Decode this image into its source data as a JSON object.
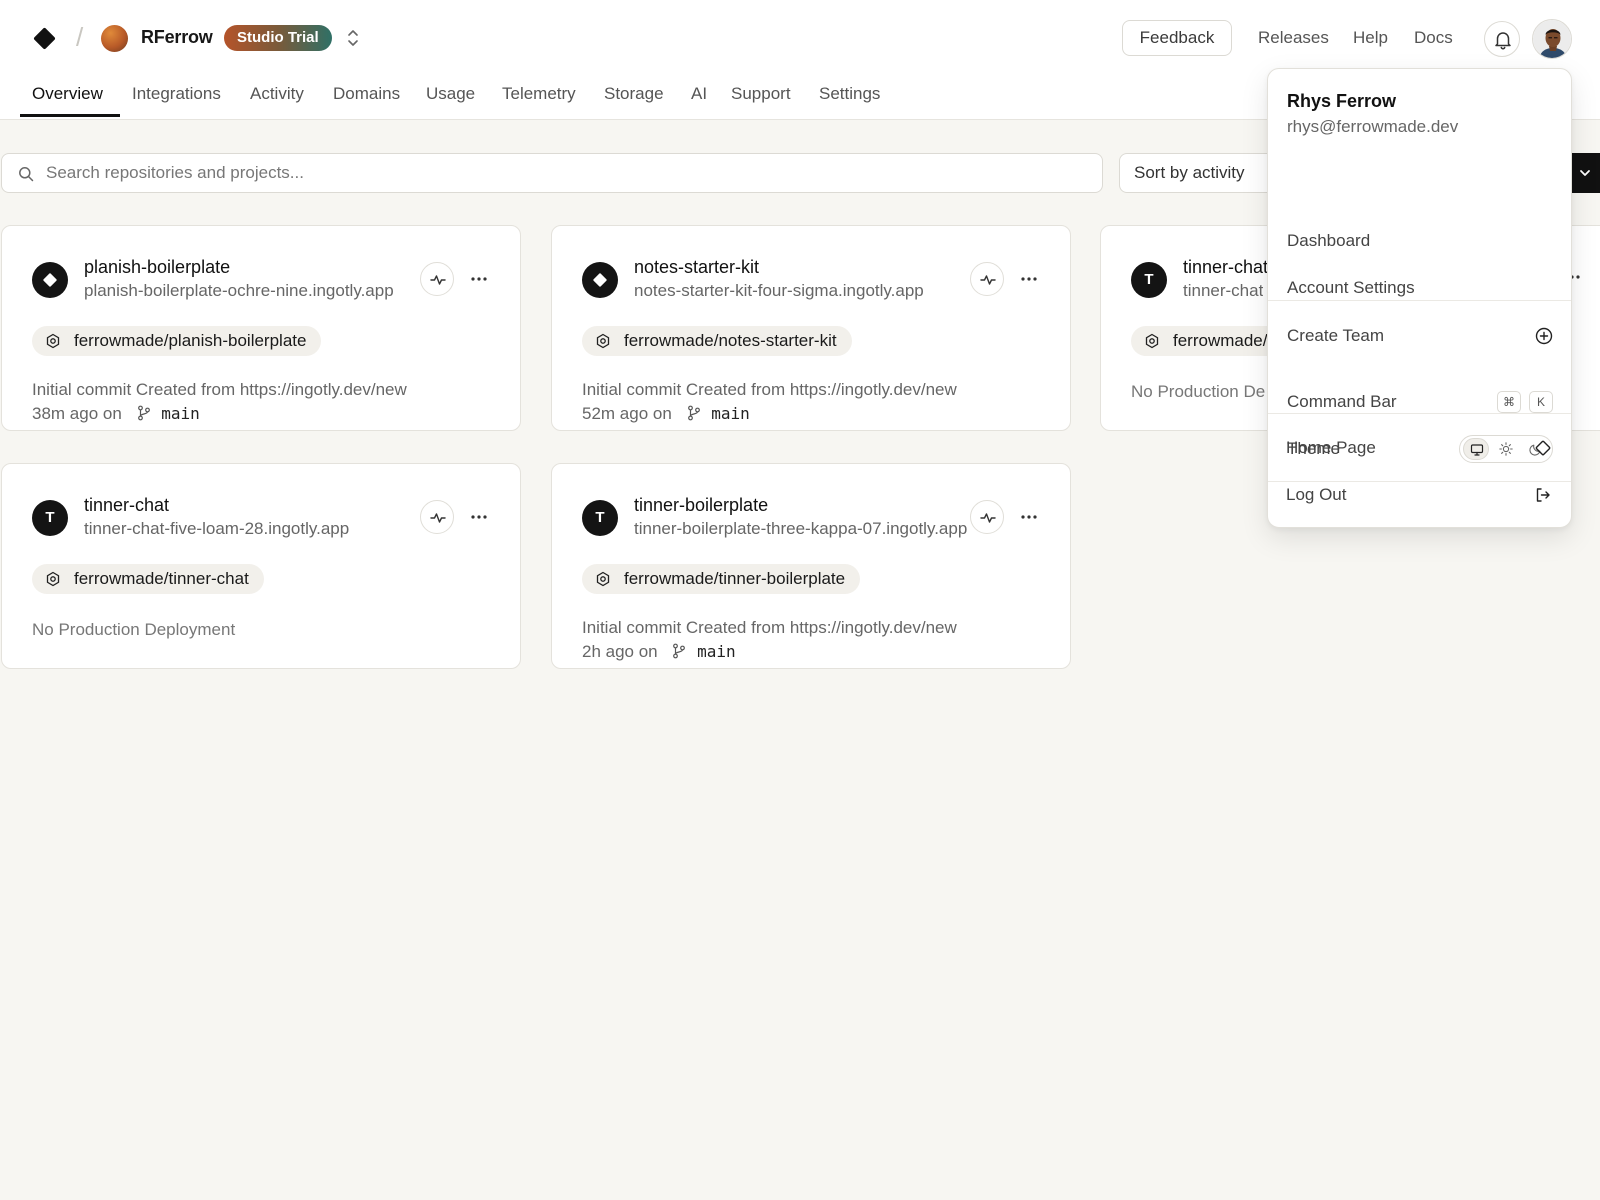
{
  "header": {
    "team_name": "RFerrow",
    "plan_badge": "Studio Trial",
    "feedback_label": "Feedback",
    "links": [
      "Releases",
      "Help",
      "Docs"
    ]
  },
  "tabs": [
    "Overview",
    "Integrations",
    "Activity",
    "Domains",
    "Usage",
    "Telemetry",
    "Storage",
    "AI",
    "Support",
    "Settings"
  ],
  "active_tab": "Overview",
  "search": {
    "placeholder": "Search repositories and projects..."
  },
  "sort": {
    "label": "Sort by activity"
  },
  "projects": [
    {
      "name": "planish-boilerplate",
      "domain": "planish-boilerplate-ochre-nine.ingotly.app",
      "icon": "diamond",
      "repo": "ferrowmade/planish-boilerplate",
      "commit": "Initial commit Created from https://ingotly.dev/new",
      "time": "38m ago on",
      "branch": "main"
    },
    {
      "name": "notes-starter-kit",
      "domain": "notes-starter-kit-four-sigma.ingotly.app",
      "icon": "diamond",
      "repo": "ferrowmade/notes-starter-kit",
      "commit": "Initial commit Created from https://ingotly.dev/new",
      "time": "52m ago on",
      "branch": "main"
    },
    {
      "name": "tinner-chat",
      "domain": "tinner-chat",
      "icon": "T",
      "repo": "ferrowmade/",
      "status": "No Production De"
    },
    {
      "name": "tinner-chat",
      "domain": "tinner-chat-five-loam-28.ingotly.app",
      "icon": "T",
      "repo": "ferrowmade/tinner-chat",
      "status": "No Production Deployment"
    },
    {
      "name": "tinner-boilerplate",
      "domain": "tinner-boilerplate-three-kappa-07.ingotly.app",
      "icon": "T",
      "repo": "ferrowmade/tinner-boilerplate",
      "commit": "Initial commit Created from https://ingotly.dev/new",
      "time": "2h ago on",
      "branch": "main"
    }
  ],
  "user_menu": {
    "name": "Rhys Ferrow",
    "email": "rhys@ferrowmade.dev",
    "items": {
      "dashboard": "Dashboard",
      "account_settings": "Account Settings",
      "create_team": "Create Team",
      "command_bar": "Command Bar",
      "theme": "Theme",
      "home_page": "Home Page",
      "log_out": "Log Out"
    },
    "command_bar_keys": [
      "⌘",
      "K"
    ],
    "theme_selected": "system"
  },
  "colors": {
    "background": "#f7f6f2",
    "surface": "#ffffff",
    "border": "#e4e2dc",
    "primary": "#111111",
    "muted_text": "#666666"
  }
}
